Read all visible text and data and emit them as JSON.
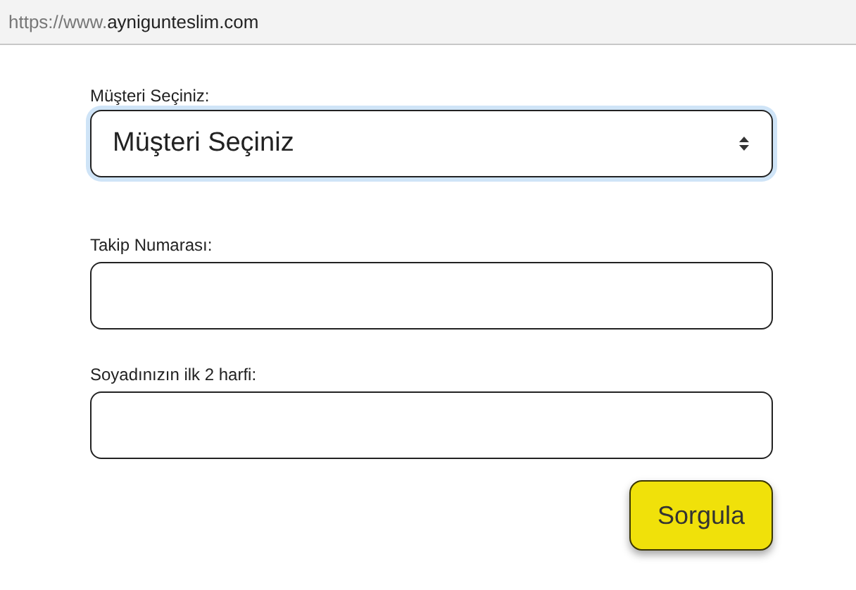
{
  "address_bar": {
    "scheme": "https://www.",
    "domain": "aynigunteslim.com"
  },
  "form": {
    "customer": {
      "label": "Müşteri Seçiniz:",
      "value": "Müşteri Seçiniz",
      "focused": true
    },
    "fields": [
      {
        "label": "Takip Numarası:"
      },
      {
        "label": "Soyadınızın ilk 2 harfi:"
      }
    ],
    "submit": "Sorgula"
  }
}
